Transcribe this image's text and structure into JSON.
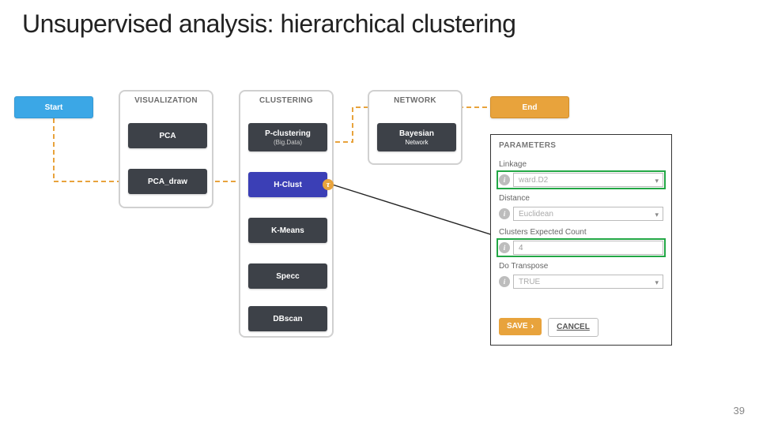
{
  "title": "Unsupervised analysis: hierarchical clustering",
  "page_number": "39",
  "workflow": {
    "start": "Start",
    "end": "End",
    "groups": {
      "visualization": {
        "header": "VISUALIZATION",
        "items": {
          "pca": "PCA",
          "pca_draw": "PCA_draw"
        }
      },
      "clustering": {
        "header": "CLUSTERING",
        "items": {
          "pclust_label": "P-clustering",
          "pclust_sub": "(Big.Data)",
          "hclust": "H-Clust",
          "kmeans": "K-Means",
          "specc": "Specc",
          "dbscan": "DBscan"
        }
      },
      "network": {
        "header": "NETWORK",
        "items": {
          "bayes_label": "Bayesian",
          "bayes_sub": "Network"
        }
      }
    },
    "tau_icon": "τ"
  },
  "panel": {
    "title": "PARAMETERS",
    "fields": {
      "linkage": {
        "label": "Linkage",
        "value": "ward.D2"
      },
      "distance": {
        "label": "Distance",
        "value": "Euclidean"
      },
      "clusters": {
        "label": "Clusters Expected Count",
        "value": "4"
      },
      "transpose": {
        "label": "Do Transpose",
        "value": "TRUE"
      }
    },
    "buttons": {
      "save": "SAVE",
      "cancel": "CANCEL"
    },
    "info_glyph": "i"
  }
}
